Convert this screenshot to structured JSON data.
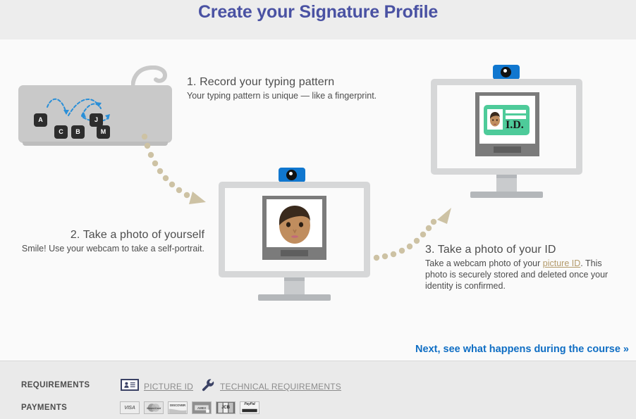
{
  "header": {
    "title": "Create your Signature Profile"
  },
  "steps": [
    {
      "id": "step-1",
      "title": "1. Record your typing pattern",
      "desc": "Your typing pattern is unique — like a fingerprint."
    },
    {
      "id": "step-2",
      "title": "2. Take a photo of yourself",
      "desc": "Smile! Use your webcam to take a self-portrait."
    },
    {
      "id": "step-3",
      "title": "3. Take a photo of your ID",
      "desc_before": "Take a webcam photo of your ",
      "desc_link": "picture ID",
      "desc_after": ". This photo is securely stored and deleted once your identity is confirmed."
    }
  ],
  "illustration": {
    "keyboard_keys": [
      "A",
      "C",
      "B",
      "J",
      "M"
    ],
    "id_card_text": "I.D.",
    "webcam_label": "webcam-icon",
    "arrow_color": "#cdc2a4",
    "key_arc_color": "#2a8fd8",
    "id_card_color": "#4ecb9a",
    "webcam_color": "#1077cf"
  },
  "next": {
    "label": "Next, see what happens during the course »",
    "color": "#0f6ec4"
  },
  "footer": {
    "requirements_label": "REQUIREMENTS",
    "payments_label": "PAYMENTS",
    "links": [
      {
        "icon": "id-card-icon",
        "label": "PICTURE ID"
      },
      {
        "icon": "wrench-icon",
        "label": "TECHNICAL REQUIREMENTS"
      }
    ],
    "payment_methods": [
      {
        "name": "visa",
        "label": "VISA"
      },
      {
        "name": "mastercard",
        "label": "MasterCard"
      },
      {
        "name": "discover",
        "label": "DISCOVER"
      },
      {
        "name": "amex",
        "label": "AMEX"
      },
      {
        "name": "jcb",
        "label": "JCB"
      },
      {
        "name": "paypal",
        "label": "PayPal"
      }
    ]
  }
}
